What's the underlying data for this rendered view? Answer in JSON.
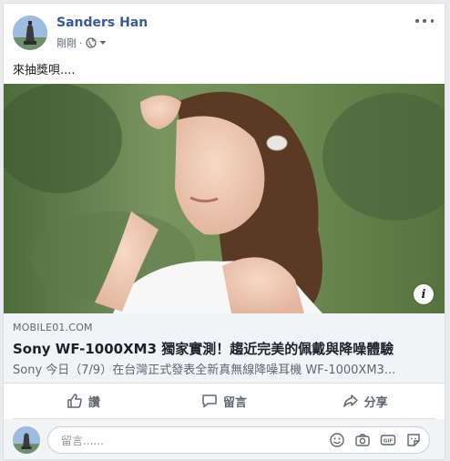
{
  "post": {
    "author": "Sanders Han",
    "timestamp": "剛剛",
    "audience_icon": "globe-icon",
    "text": "來抽獎唄....",
    "image_icon": "info-icon"
  },
  "link_preview": {
    "domain": "MOBILE01.COM",
    "title": "Sony WF-1000XM3 獨家實測！趨近完美的佩戴與降噪體驗",
    "description": "Sony 今日（7/9）在台灣正式發表全新真無線降噪耳機 WF-1000XM3..."
  },
  "actions": {
    "like": "讚",
    "comment": "留言",
    "share": "分享"
  },
  "comment_box": {
    "placeholder": "留言......",
    "icons": [
      "emoji-icon",
      "camera-icon",
      "gif-icon",
      "sticker-icon"
    ]
  },
  "colors": {
    "author_blue": "#385898",
    "muted": "#606770",
    "preview_bg": "#f2f3f5"
  }
}
